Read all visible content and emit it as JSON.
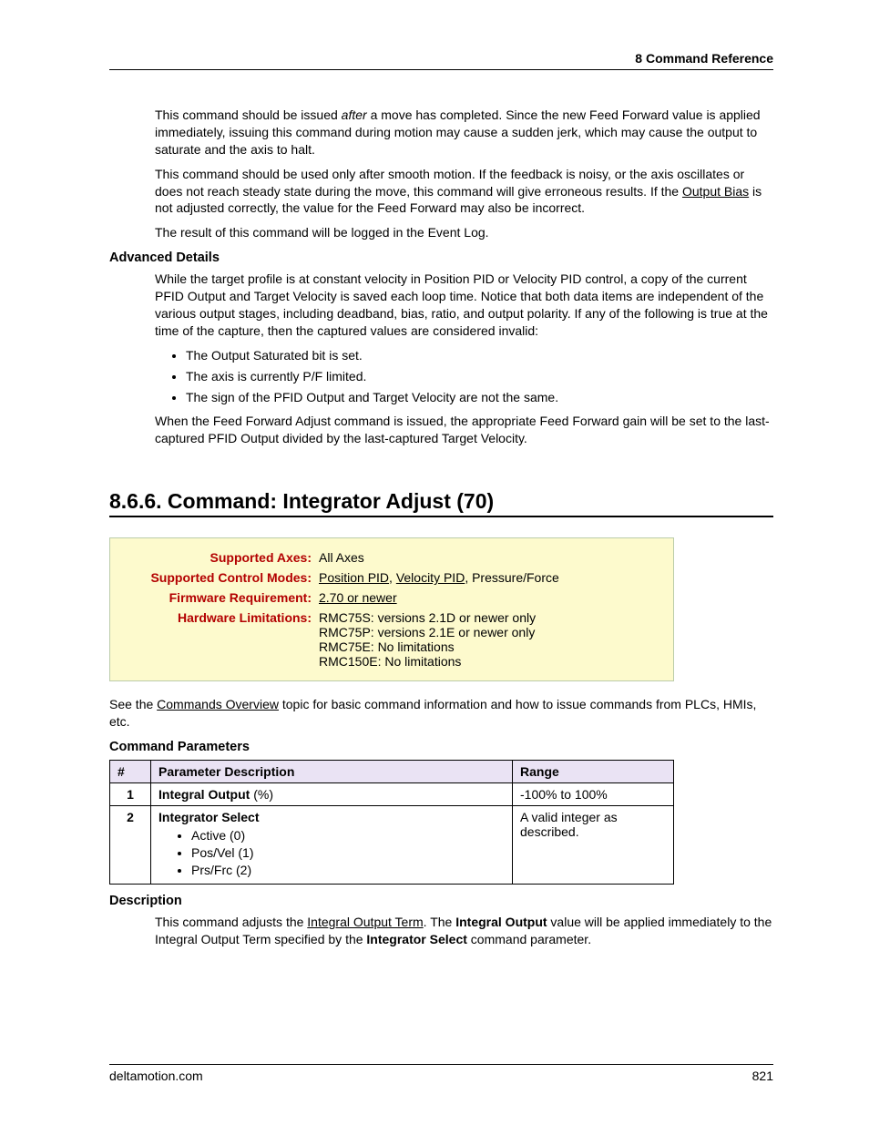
{
  "header": {
    "title": "8  Command Reference"
  },
  "intro": {
    "p1_a": "This command should be issued ",
    "p1_after": "after",
    "p1_b": " a move has completed. Since the new Feed Forward value is applied immediately, issuing this command during motion may cause a sudden jerk, which may cause the output to saturate and the axis to halt.",
    "p2_a": "This command should be used only after smooth motion. If the feedback is noisy, or the axis oscillates or does not reach steady state during the move, this command will give erroneous results. If the ",
    "p2_link": "Output Bias",
    "p2_b": " is not adjusted correctly, the value for the Feed Forward may also be incorrect.",
    "p3": "The result of this command will be logged in the Event Log."
  },
  "advanced": {
    "heading": "Advanced Details",
    "p1": "While the target profile is at constant velocity in Position PID or Velocity PID control, a copy of the current PFID Output and Target Velocity is saved each loop time. Notice that both data items are independent of the various output stages, including deadband, bias, ratio, and output polarity. If any of the following is true at the time of the capture, then the captured values are considered invalid:",
    "bullets": [
      "The Output Saturated bit is set.",
      "The axis is currently P/F limited.",
      "The sign of the PFID Output and Target Velocity are not the same."
    ],
    "p2": "When the Feed Forward Adjust command is issued, the appropriate Feed Forward gain will be set to the last-captured PFID Output divided by the last-captured Target Velocity."
  },
  "section": {
    "title": "8.6.6. Command: Integrator Adjust (70)",
    "info": {
      "axes_label": "Supported Axes:",
      "axes_value": "All Axes",
      "modes_label": "Supported Control Modes:",
      "modes_link1": "Position PID",
      "modes_sep": ", ",
      "modes_link2": "Velocity PID",
      "modes_tail": ", Pressure/Force",
      "fw_label": "Firmware Requirement:",
      "fw_link": "2.70 or newer",
      "hw_label": "Hardware Limitations:",
      "hw_lines": [
        "RMC75S: versions 2.1D or newer only",
        "RMC75P: versions 2.1E or newer only",
        "RMC75E: No limitations",
        "RMC150E: No limitations"
      ]
    },
    "see_a": "See the ",
    "see_link": "Commands Overview",
    "see_b": " topic for basic command information and how to issue commands from PLCs, HMIs, etc.",
    "params_heading": "Command Parameters",
    "params_headers": {
      "num": "#",
      "desc": "Parameter Description",
      "range": "Range"
    },
    "params_rows": [
      {
        "num": "1",
        "desc_bold": "Integral Output",
        "desc_tail": " (%)",
        "range": "-100% to 100%"
      },
      {
        "num": "2",
        "desc_bold": "Integrator Select",
        "options": [
          "Active (0)",
          "Pos/Vel (1)",
          "Prs/Frc (2)"
        ],
        "range": "A valid integer as described."
      }
    ],
    "desc_heading": "Description",
    "desc_a": "This command adjusts the ",
    "desc_link": "Integral Output Term",
    "desc_b": ". The ",
    "desc_bold1": "Integral Output",
    "desc_c": " value will be applied immediately to the Integral Output Term specified by the ",
    "desc_bold2": "Integrator Select",
    "desc_d": " command parameter."
  },
  "footer": {
    "site": "deltamotion.com",
    "page": "821"
  }
}
